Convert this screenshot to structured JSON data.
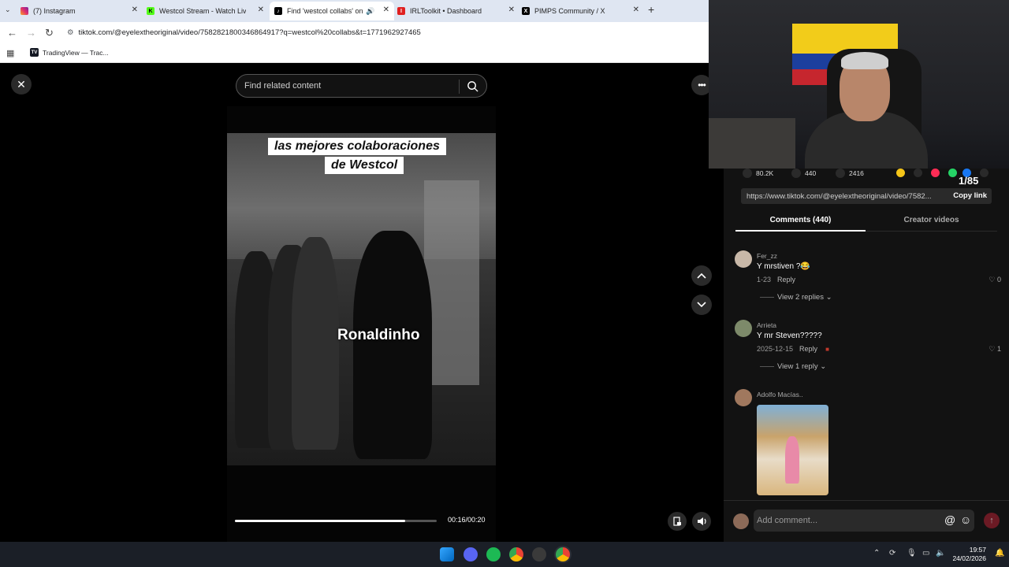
{
  "browser": {
    "tabs": [
      {
        "title": "(7) Instagram",
        "color": "#e1306c",
        "glyph": ""
      },
      {
        "title": "Westcol Stream - Watch Live on",
        "color": "#53fc18",
        "glyph": "K"
      },
      {
        "title": "Find 'westcol collabs' on TikTok",
        "color": "#000000",
        "glyph": "♪"
      },
      {
        "title": "IRLToolkit • Dashboard",
        "color": "#e02020",
        "glyph": "I"
      },
      {
        "title": "PIMPS Community / X",
        "color": "#000000",
        "glyph": "X"
      }
    ],
    "address": "tiktok.com/@eyelextheoriginal/video/7582821800346864917?q=westcol%20collabs&t=1771962927465",
    "bookmarks": [
      {
        "label": "TradingView — Trac..."
      }
    ]
  },
  "tiktok": {
    "search_placeholder": "Find related content",
    "video": {
      "caption_line1": "las mejores colaboraciones",
      "caption_line2": "de Westcol",
      "overlay_name": "Ronaldinho",
      "progress": 0.845,
      "timecode": "00:16/00:20"
    },
    "stats": {
      "likes": "80.2K",
      "comments": "440",
      "saves": "2416"
    },
    "page_counter": "1/85",
    "share_link": "https://www.tiktok.com/@eyelextheoriginal/video/7582...",
    "copy_link_label": "Copy link",
    "tab_comments": "Comments (440)",
    "tab_creator": "Creator videos",
    "comments": [
      {
        "user": "Fer_zz",
        "text": "Y mrstiven ?😂",
        "date": "1-23",
        "reply": "Reply",
        "likes": "0",
        "replies": "View 2 replies ⌄",
        "avatar_color": "#c8b8a8"
      },
      {
        "user": "Arrieta",
        "text": "Y mr Steven?????",
        "date": "2025-12-15",
        "reply": "Reply",
        "likes": "1",
        "replies": "View 1 reply ⌄",
        "avatar_color": "#7d8a6a"
      },
      {
        "user": "Adolfo Macías..",
        "avatar_color": "#a0785e"
      }
    ],
    "add_comment_placeholder": "Add comment..."
  },
  "taskbar": {
    "time": "19:57",
    "date": "24/02/2026"
  }
}
